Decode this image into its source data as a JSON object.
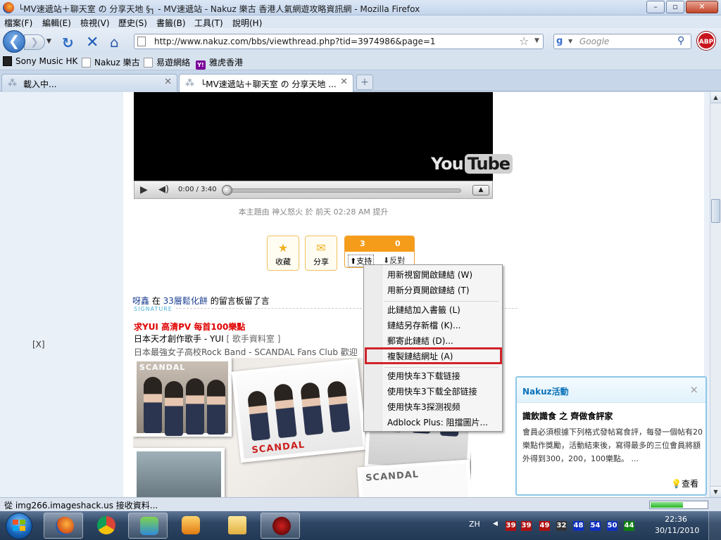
{
  "window": {
    "title": "└MV速遞站＋聊天室 の 分享天地 §┐ - MV速遞站 - Nakuz 樂古 香港人氣網遊攻略資訊網 - Mozilla Firefox",
    "minimize": "–",
    "maximize": "▫",
    "close": "✕"
  },
  "menu": [
    "檔案(F)",
    "編輯(E)",
    "檢視(V)",
    "歷史(S)",
    "書籤(B)",
    "工具(T)",
    "說明(H)"
  ],
  "nav": {
    "back_icon": "❮",
    "forward_icon": "❯",
    "history_dropdown": "▼",
    "reload_icon": "↻",
    "stop_icon": "✕",
    "home_icon": "⌂",
    "url": "http://www.nakuz.com/bbs/viewthread.php?tid=3974986&page=1",
    "star_icon": "☆",
    "url_dropdown": "▼",
    "search_engine_icon": "g",
    "search_dropdown": "▼",
    "search_placeholder": "Google",
    "search_icon": "⚲",
    "abp_label": "ABP"
  },
  "bookmarks": [
    "Sony Music HK",
    "Nakuz 樂古",
    "易遊網絡",
    "雅虎香港"
  ],
  "yahoo_badge": "Y!",
  "tabs": [
    {
      "label": "載入中...",
      "spinner": "⁂",
      "close": "✕"
    },
    {
      "label": "└MV速遞站＋聊天室 の 分享天地 ...",
      "spinner": "⁂",
      "close": "✕"
    }
  ],
  "new_tab": "+",
  "page": {
    "close_ad": "[X]",
    "video": {
      "logo_you": "You",
      "logo_tube": "Tube",
      "play_icon": "▶",
      "volume_icon": "◀)",
      "time": "0:00 / 3:40",
      "fullscreen_icon": "▲"
    },
    "promote_note": "本主題由 神乂怒火 於 前天 02:28 AM 提升",
    "actions": {
      "favorite_icon": "★",
      "favorite": "收藏",
      "share_icon": "✉",
      "share": "分享",
      "support_count": "3",
      "oppose_count": "0",
      "support": "⬆支持",
      "oppose": "⬇反對"
    },
    "comment": {
      "user": "呀鑫",
      "mid": " 在 ",
      "target": "33層鬆化餅",
      "tail": " 的留言板留了言"
    },
    "signature_label": "SIGNATURE",
    "sig_line1": "求YUI 高清PV 每首100樂點",
    "sig_line2": "日本天才創作歌手 - YUI",
    "sig_line2_tag": " [ 歌手資料室 ]",
    "sig_line3": "日本最強女子高校Rock Band  - SCANDAL Fans Club 歡迎",
    "photo_text": [
      "SCANDAL",
      "SCANDAL",
      "SCANDAL"
    ]
  },
  "context_menu": [
    "用新視窗開啟鏈結 (W)",
    "用新分頁開啟鏈結 (T)",
    "此鏈結加入書籤 (L)",
    "鏈結另存新檔 (K)...",
    "郵寄此鏈結 (D)...",
    "複製鏈結網址 (A)",
    "使用快车3下载链接",
    "使用快车3下载全部链接",
    "使用快车3探测视频",
    "Adblock Plus: 阻擋圖片..."
  ],
  "popup": {
    "title": "Nakuz活動",
    "close": "×",
    "subtitle": "識飲識食 之 齊做食評家",
    "body": "會員必須根據下列格式發帖寫食評，每發一個帖有20樂點作獎勵，活動結束後，寫得最多的三位會員將額外得到300，200，100樂點。 ...",
    "view_icon": "💡",
    "view": "查看"
  },
  "scrollbar": {
    "up": "▲",
    "down": "▼"
  },
  "status": {
    "text": "從 img266.imageshack.us 接收資料...",
    "progress": 0.58
  },
  "taskbar": {
    "lang": "ZH",
    "tray_arrow": "◀",
    "tray_numbers": [
      "39",
      "39",
      "49",
      "32",
      "48",
      "54",
      "50",
      "44"
    ],
    "tray_colors": [
      "#b01010",
      "#b01010",
      "#b01010",
      "#333333",
      "#1030c0",
      "#1030c0",
      "#1030c0",
      "#108010"
    ],
    "time": "22:36",
    "date": "30/11/2010"
  }
}
